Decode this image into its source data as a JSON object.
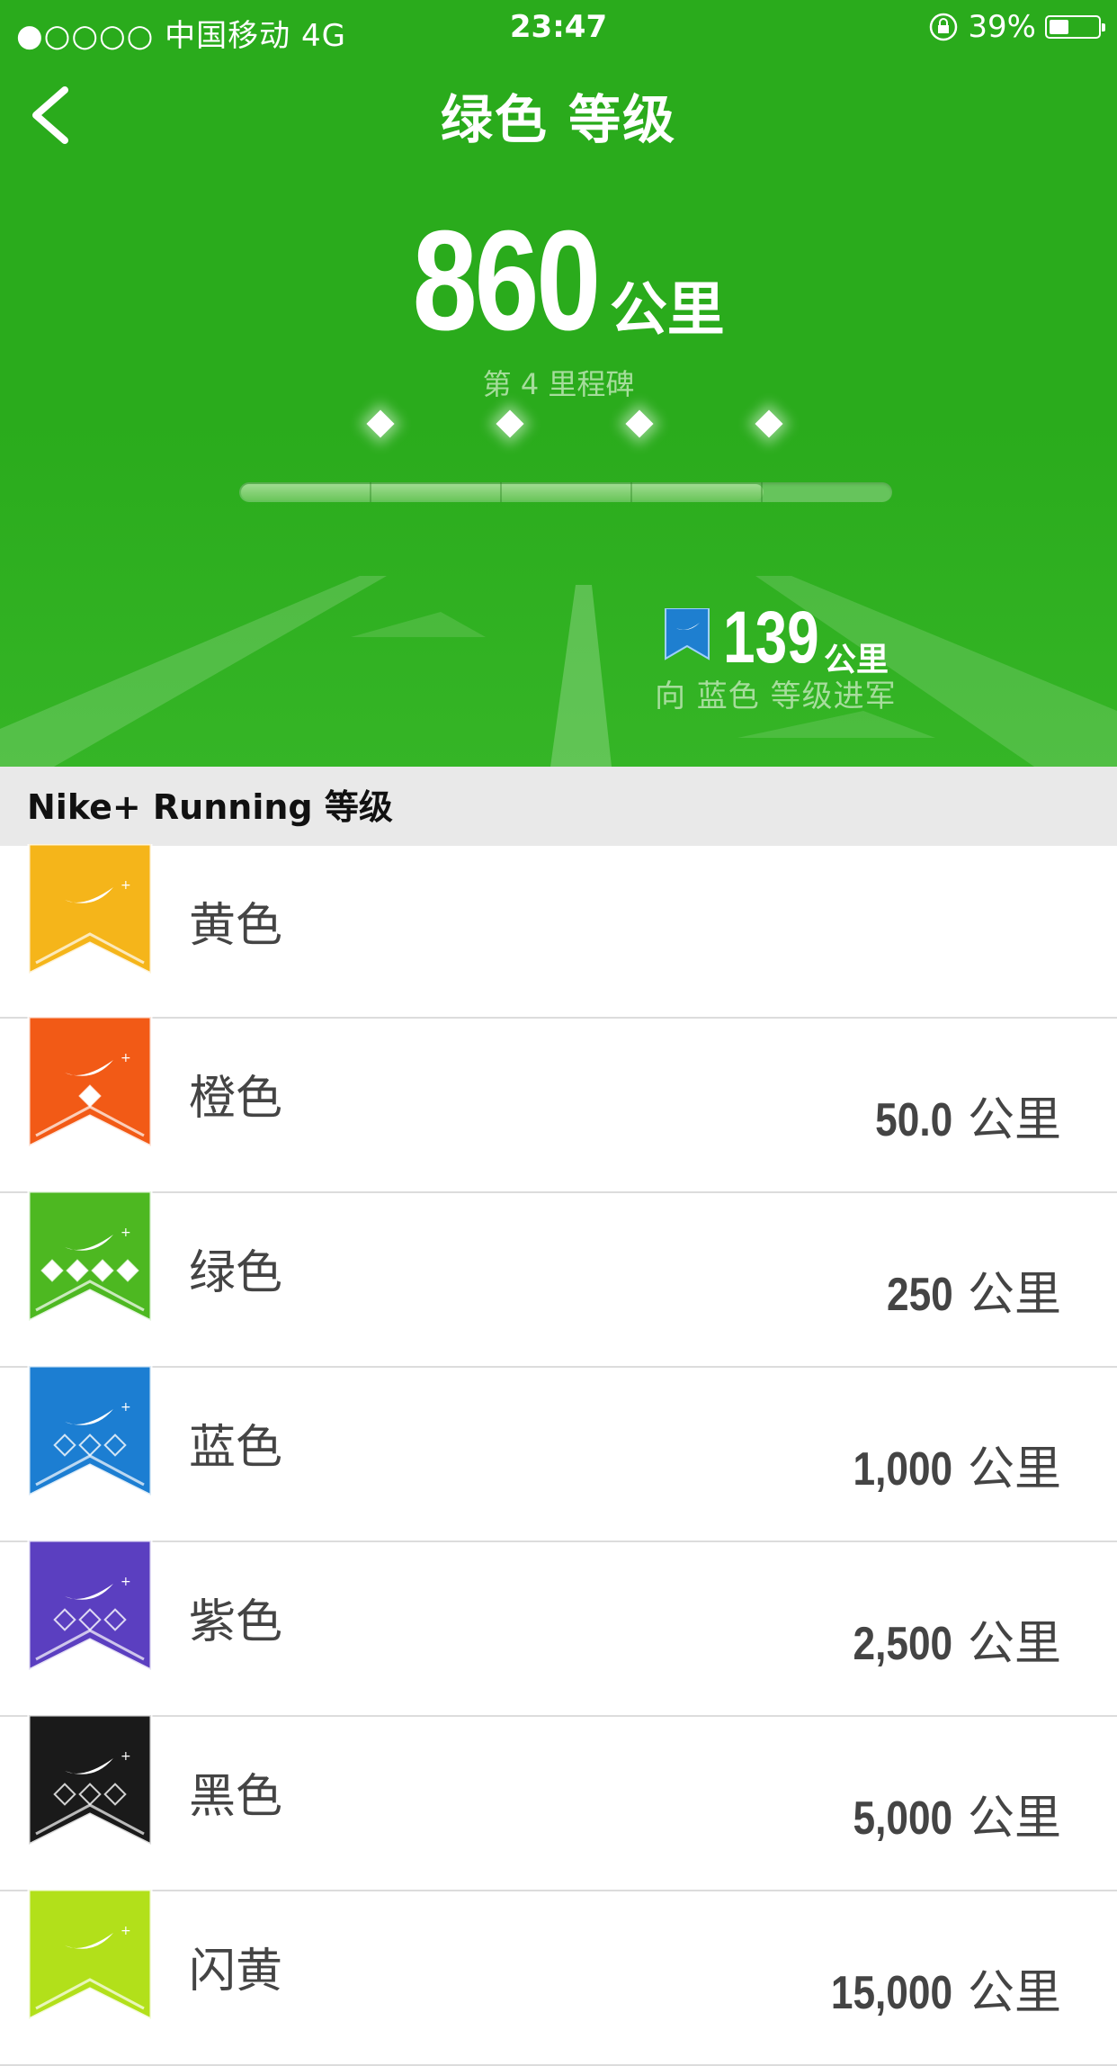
{
  "status_bar": {
    "carrier": "●○○○○ 中国移动   4G",
    "time": "23:47",
    "battery": "39%",
    "battery_level": 0.39
  },
  "nav": {
    "title": "绿色 等级",
    "back_icon": "chevron-left-icon"
  },
  "current": {
    "distance": "860",
    "unit": "公里",
    "milestone": "第 4 里程碑",
    "milestones_reached": 4,
    "progress_fraction": 0.8
  },
  "next_level": {
    "remaining": "139",
    "unit": "公里",
    "caption": "向 蓝色 等级进军",
    "flag_color": "#1e7fd0"
  },
  "section": {
    "title": "Nike+ Running 等级"
  },
  "levels": [
    {
      "name": "黄色",
      "threshold": "",
      "unit": "",
      "color": "#f5b51a",
      "diamonds": 0
    },
    {
      "name": "橙色",
      "threshold": "50.0",
      "unit": "公里",
      "color": "#f25a16",
      "diamonds": 1
    },
    {
      "name": "绿色",
      "threshold": "250",
      "unit": "公里",
      "color": "#4db821",
      "diamonds": 4
    },
    {
      "name": "蓝色",
      "threshold": "1,000",
      "unit": "公里",
      "color": "#1c7ed2",
      "diamonds": 3
    },
    {
      "name": "紫色",
      "threshold": "2,500",
      "unit": "公里",
      "color": "#5b3fc0",
      "diamonds": 3
    },
    {
      "name": "黑色",
      "threshold": "5,000",
      "unit": "公里",
      "color": "#1a1a1a",
      "diamonds": 3
    },
    {
      "name": "闪黄",
      "threshold": "15,000",
      "unit": "公里",
      "color": "#b2e01a",
      "diamonds": 0
    }
  ]
}
